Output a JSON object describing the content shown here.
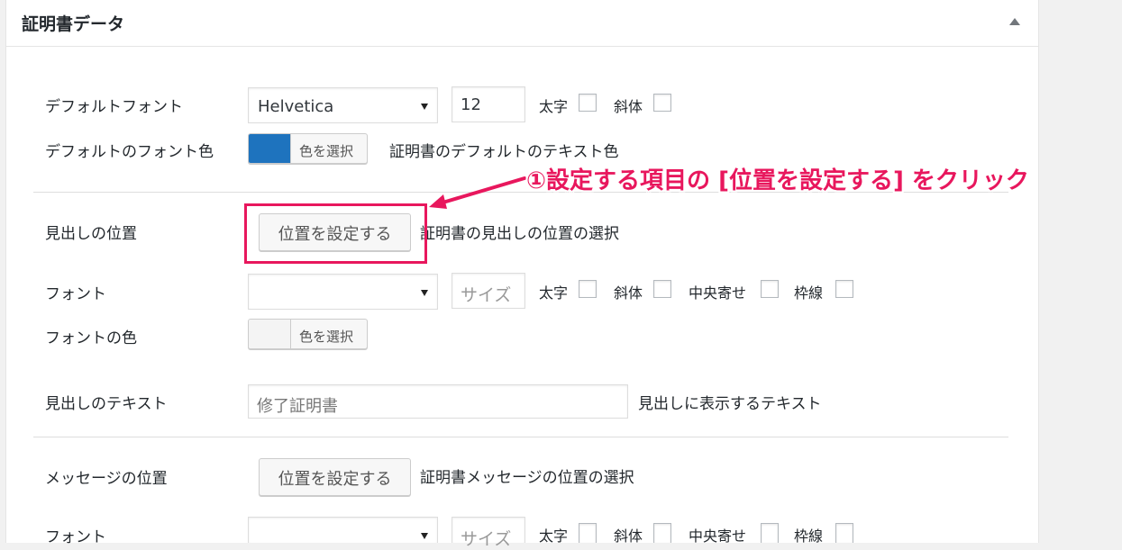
{
  "panel": {
    "title": "証明書データ"
  },
  "default_font": {
    "label": "デフォルトフォント",
    "font_value": "Helvetica",
    "size_value": "12",
    "bold_label": "太字",
    "italic_label": "斜体"
  },
  "default_color": {
    "label": "デフォルトのフォント色",
    "button_label": "色を選択",
    "swatch_color": "#1e73be",
    "description": "証明書のデフォルトのテキスト色"
  },
  "heading_position": {
    "label": "見出しの位置",
    "button_label": "位置を設定する",
    "description": "証明書の見出しの位置の選択"
  },
  "heading_font": {
    "label": "フォント",
    "size_placeholder": "サイズ",
    "bold_label": "太字",
    "italic_label": "斜体",
    "center_label": "中央寄せ",
    "border_label": "枠線"
  },
  "heading_color": {
    "label": "フォントの色",
    "button_label": "色を選択"
  },
  "heading_text": {
    "label": "見出しのテキスト",
    "value": "修了証明書",
    "description": "見出しに表示するテキスト"
  },
  "message_position": {
    "label": "メッセージの位置",
    "button_label": "位置を設定する",
    "description": "証明書メッセージの位置の選択"
  },
  "message_font": {
    "label": "フォント",
    "size_placeholder": "サイズ",
    "bold_label": "太字",
    "italic_label": "斜体",
    "center_label": "中央寄せ",
    "border_label": "枠線"
  },
  "annotation": {
    "text": "①設定する項目の [位置を設定する] をクリック",
    "color": "#e8175d"
  }
}
